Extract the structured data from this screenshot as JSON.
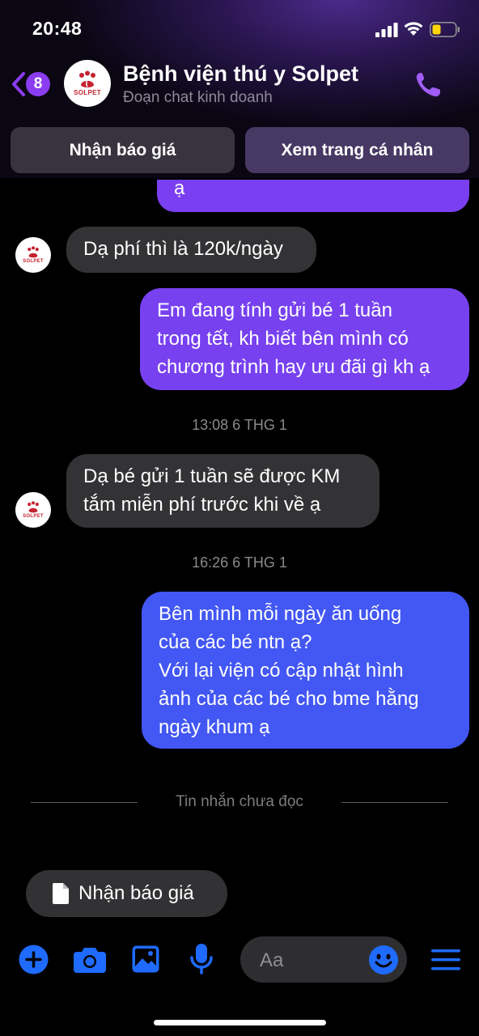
{
  "status": {
    "time": "20:48"
  },
  "header": {
    "back_badge": "8",
    "avatar_brand": "SOLPET",
    "title": "Bệnh viện thú y Solpet",
    "subtitle": "Đoạn chat kinh doanh"
  },
  "quick_actions": [
    "Nhận báo giá",
    "Xem trang cá nhân"
  ],
  "messages": {
    "top_partial": "ạ",
    "m1": "Dạ phí thì là 120k/ngày",
    "m2_lines": [
      "Em đang tính gửi bé 1 tuần",
      "trong tết, kh biết bên mình có",
      "chương trình hay ưu đãi gì kh ạ"
    ],
    "ts1": "13:08 6 THG 1",
    "m3_lines": [
      "Dạ bé gửi 1 tuần sẽ được KM",
      "tắm miễn phí trước khi về ạ"
    ],
    "ts2": "16:26 6 THG 1",
    "m4_lines": [
      "Bên mình mỗi ngày ăn uống",
      "của các bé ntn ạ?",
      "Với lại viện có cập nhật hình",
      "ảnh của các bé cho bme hằng",
      "ngày khum ạ"
    ]
  },
  "unread_divider": "Tin nhắn chưa đọc",
  "suggestion": {
    "label": "Nhận báo giá",
    "icon": "document-icon"
  },
  "composer": {
    "placeholder": "Aa"
  },
  "colors": {
    "accent": "#8a3cf0",
    "outgoing_purple": "#7b3ff0",
    "outgoing_blue": "#3d5cf5",
    "incoming": "#333336",
    "composer_blue": "#1f6bff"
  }
}
